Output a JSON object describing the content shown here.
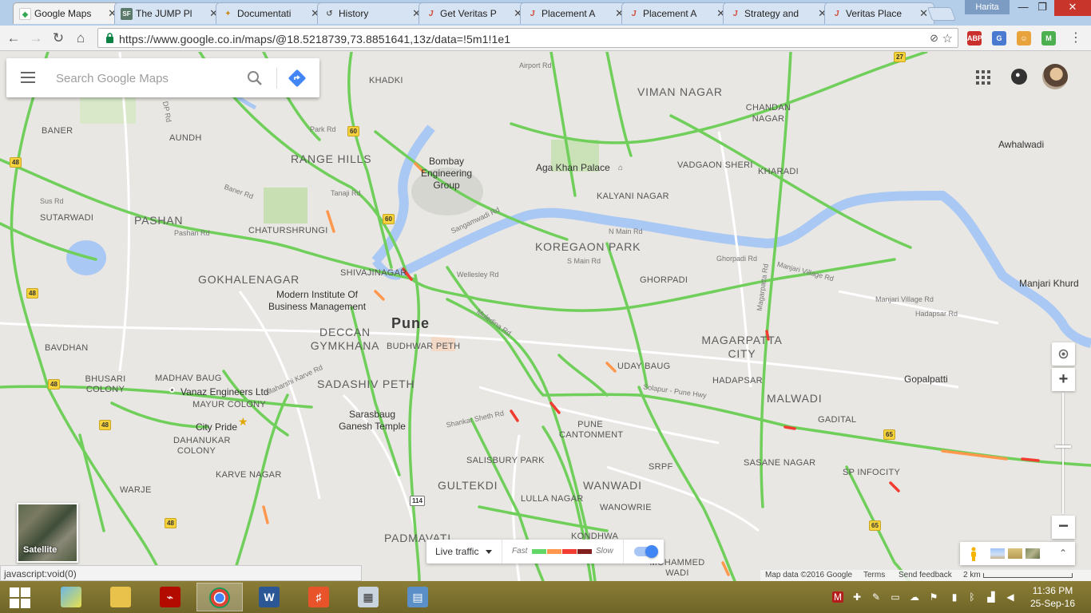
{
  "browser": {
    "tabs": [
      {
        "title": "Google Maps",
        "favicon": "google-maps-favicon",
        "active": true
      },
      {
        "title": "The JUMP Pl",
        "favicon": "sf-favicon"
      },
      {
        "title": "Documentati",
        "favicon": "bird-favicon"
      },
      {
        "title": "History",
        "favicon": "history-icon"
      },
      {
        "title": "Get Veritas P",
        "favicon": "j-favicon"
      },
      {
        "title": "Placement A",
        "favicon": "j-favicon"
      },
      {
        "title": "Placement A",
        "favicon": "j-favicon"
      },
      {
        "title": "Strategy and",
        "favicon": "j-favicon"
      },
      {
        "title": "Veritas Place",
        "favicon": "j-favicon"
      }
    ],
    "profile_name": "Harita",
    "url": "https://www.google.co.in/maps/@18.5218739,73.8851641,13z/data=!5m1!1e1",
    "status_url": "javascript:void(0)"
  },
  "search": {
    "placeholder": "Search Google Maps"
  },
  "map": {
    "city_label": "Pune",
    "area_labels": [
      "KHADKI",
      "VIMAN NAGAR",
      "CHANDAN NAGAR",
      "BANER",
      "AUNDH",
      "RANGE HILLS",
      "VADGAON SHERI",
      "KHARADI",
      "PASHAN",
      "SUTARWADI",
      "KALYANI NAGAR",
      "CHATURSHRUNGI",
      "KOREGAON PARK",
      "GOKHALENAGAR",
      "SHIVAJINAGAR",
      "GHORPADI",
      "DECCAN GYMKHANA",
      "BUDHWAR PETH",
      "MAGARPATTA CITY",
      "BAVDHAN",
      "UDAY BAUG",
      "BHUSARI COLONY",
      "MADHAV BAUG",
      "SADASHIV PETH",
      "HADAPSAR",
      "MALWADI",
      "MAYUR COLONY",
      "GADITAL",
      "DAHANUKAR COLONY",
      "PUNE CANTONMENT",
      "SALISBURY PARK",
      "SASANE NAGAR",
      "SRPF",
      "SP INFOCITY",
      "KARVE NAGAR",
      "GULTEKDI",
      "WANWADI",
      "WARJE",
      "LULLA NAGAR",
      "WANOWRIE",
      "PADMAVATI",
      "KONDHWA",
      "MOHAMMED WADI",
      "Awhalwadi",
      "Manjari Khurd",
      "Gopalpatti"
    ],
    "poi_labels": [
      "Bombay Engineering Group",
      "Aga Khan Palace",
      "Modern Institute Of Business Management",
      "Vanaz Engineers Ltd",
      "City Pride",
      "Sarasbaug Ganesh Temple"
    ],
    "road_labels": [
      "Airport Rd",
      "DP Rd",
      "Park Rd",
      "Baner Rd",
      "Tanaji Rd",
      "Pashan Rd",
      "Sus Rd",
      "Sangamwadi Rd",
      "N Main Rd",
      "S Main Rd",
      "Wellesley Rd",
      "Moledina Rd",
      "Ghorpadi Rd",
      "Manjari Village Rd",
      "Hadapsar Rd",
      "Solapur - Pune Hwy",
      "Shankar Sheth Rd",
      "Maharshi Karve Rd",
      "Magarpatta Rd",
      "Nalstop Rd"
    ],
    "highway_shields": [
      "48",
      "60",
      "27",
      "65",
      "114"
    ]
  },
  "controls": {
    "satellite_label": "Satellite",
    "traffic_label": "Live traffic",
    "fast_label": "Fast",
    "slow_label": "Slow",
    "traffic_colors": [
      "#63d668",
      "#ff974d",
      "#f23c32",
      "#811f1f"
    ],
    "live_traffic_on": true,
    "zoom_in_label": "+",
    "zoom_out_label": "−"
  },
  "attribution": {
    "map_data": "Map data ©2016 Google",
    "terms": "Terms",
    "feedback": "Send feedback",
    "scale": "2 km"
  },
  "taskbar": {
    "time": "11:36 PM",
    "date": "25-Sep-16"
  }
}
